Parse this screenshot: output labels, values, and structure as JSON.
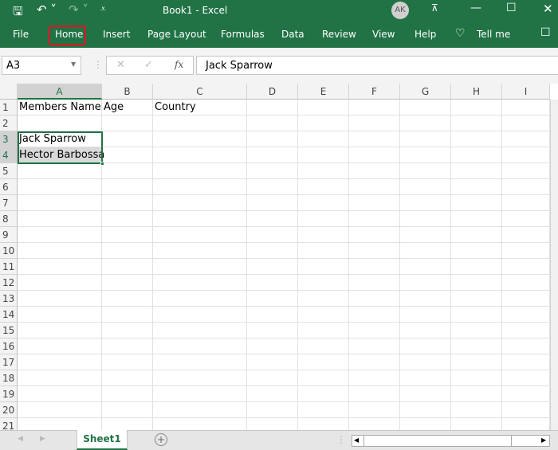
{
  "window": {
    "title": "Book1  -  Excel",
    "user_initials": "AK"
  },
  "ribbon": {
    "tabs": [
      "File",
      "Home",
      "Insert",
      "Page Layout",
      "Formulas",
      "Data",
      "Review",
      "View",
      "Help"
    ],
    "tell_me": "Tell me",
    "highlighted_tab": "Home"
  },
  "formula_bar": {
    "name_box": "A3",
    "cancel": "✕",
    "enter": "✓",
    "fx": "fx",
    "value": "Jack Sparrow"
  },
  "columns": [
    "A",
    "B",
    "C",
    "D",
    "E",
    "F",
    "G",
    "H",
    "I"
  ],
  "rows": [
    "1",
    "2",
    "3",
    "4",
    "5",
    "6",
    "7",
    "8",
    "9",
    "10",
    "11",
    "12",
    "13",
    "14",
    "15",
    "16",
    "17",
    "18",
    "19",
    "20",
    "21"
  ],
  "cells": {
    "A1": "Members Name",
    "B1": "Age",
    "C1": "Country",
    "A3": "Jack Sparrow",
    "A4": "Hector Barbossa"
  },
  "sheets": {
    "active": "Sheet1"
  },
  "colors": {
    "brand": "#217346",
    "highlight": "#e81123"
  }
}
